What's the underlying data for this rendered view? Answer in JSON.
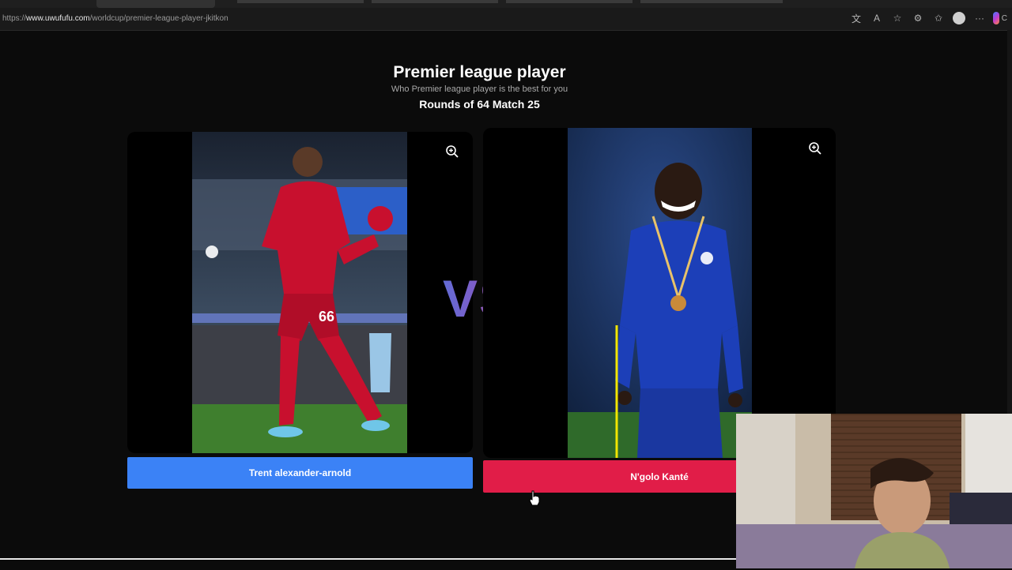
{
  "browser": {
    "url_scheme": "https://",
    "url_host": "www.uwufufu.com",
    "url_path": "/worldcup/premier-league-player-jkitkon",
    "copilot_label": "C"
  },
  "header": {
    "title": "Premier league player",
    "subtitle": "Who Premier league player is the best for you",
    "round_info": "Rounds of 64 Match 25"
  },
  "vs_label": "VS",
  "candidates": [
    {
      "name": "Trent alexander-arnold",
      "kit_color": "#c8102e",
      "button_color": "#3b82f6",
      "number": "66"
    },
    {
      "name": "N'golo Kanté",
      "kit_color": "#1c3fb8",
      "button_color": "#e11d48"
    }
  ]
}
